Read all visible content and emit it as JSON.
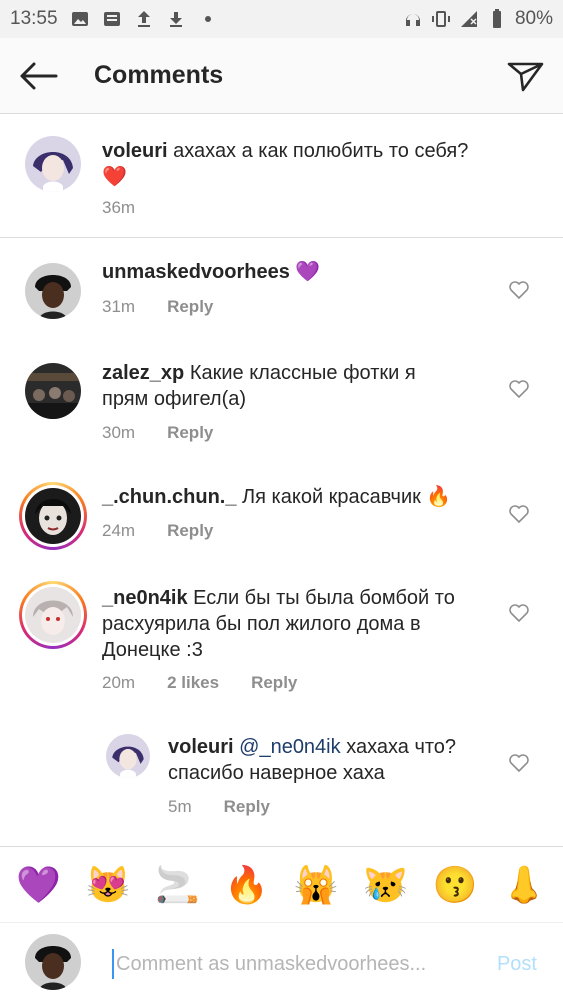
{
  "status_bar": {
    "time": "13:55",
    "battery": "80%"
  },
  "header": {
    "title": "Comments"
  },
  "caption": {
    "username": "voleuri",
    "text": "ахахах а как полюбить то себя?",
    "emoji": "❤️",
    "time": "36m"
  },
  "comments": [
    {
      "username": "unmaskedvoorhees",
      "text": "💜",
      "time": "31m",
      "reply_label": "Reply"
    },
    {
      "username": "zalez_xp",
      "text": "Какие классные фотки я",
      "text2": "прям офигел(а)",
      "time": "30m",
      "reply_label": "Reply"
    },
    {
      "username": "_.chun.chun._",
      "text": "Ля какой красавчик 🔥",
      "time": "24m",
      "reply_label": "Reply"
    },
    {
      "username": "_ne0n4ik",
      "text": "Если бы ты была бомбой то",
      "text2": "расхуярила бы пол жилого дома в",
      "text3": "Донецке :3",
      "time": "20m",
      "likes": "2 likes",
      "reply_label": "Reply"
    }
  ],
  "reply": {
    "username": "voleuri",
    "mention": "@_ne0n4ik",
    "text": "хахаха что?",
    "text2": "спасибо наверное хаха",
    "time": "5m",
    "reply_label": "Reply"
  },
  "emoji_bar": [
    "💜",
    "😻",
    "🚬",
    "🔥",
    "🙀",
    "😿",
    "😗",
    "👃"
  ],
  "composer": {
    "placeholder": "Comment as unmaskedvoorhees...",
    "post_label": "Post"
  },
  "colors": {
    "link": "#1f3d6b",
    "post_disabled": "#b2dffc",
    "meta": "#8e8e8e"
  }
}
